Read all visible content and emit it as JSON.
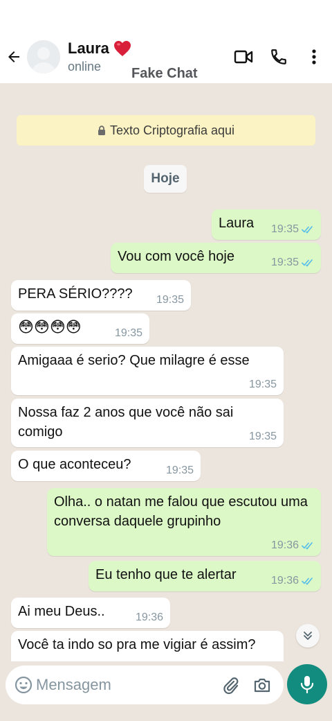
{
  "header": {
    "contact_name": "Laura",
    "status": "online",
    "watermark": "Fake Chat"
  },
  "encryption_notice": "Texto Criptografia aqui",
  "date_separator": "Hoje",
  "messages": [
    {
      "dir": "out",
      "text": "Laura",
      "time": "19:35",
      "read": true
    },
    {
      "dir": "out",
      "text": "Vou com você hoje",
      "time": "19:35",
      "read": true
    },
    {
      "dir": "in",
      "text": "PERA SÉRIO????",
      "time": "19:35"
    },
    {
      "dir": "in",
      "text": "😳😳😳😳",
      "time": "19:35"
    },
    {
      "dir": "in",
      "text": "Amigaaa é serio? Que milagre é esse",
      "time": "19:35"
    },
    {
      "dir": "in",
      "text": "Nossa faz 2 anos que você não sai comigo",
      "time": "19:35"
    },
    {
      "dir": "in",
      "text": "O que aconteceu?",
      "time": "19:35"
    },
    {
      "dir": "out",
      "text": "Olha..  o natan me falou que escutou uma conversa daquele grupinho",
      "time": "19:36",
      "read": true
    },
    {
      "dir": "out",
      "text": "Eu tenho que te alertar",
      "time": "19:36",
      "read": true
    },
    {
      "dir": "in",
      "text": "Ai meu Deus..",
      "time": "19:36"
    },
    {
      "dir": "in",
      "text": "Você ta indo so pra me vigiar é assim?",
      "time": ""
    }
  ],
  "composer": {
    "placeholder": "Mensagem"
  },
  "colors": {
    "chat_bg": "#ece5dd",
    "outgoing": "#dcf8c6",
    "incoming": "#ffffff",
    "accent": "#128c7e",
    "read_tick": "#53bdeb"
  }
}
